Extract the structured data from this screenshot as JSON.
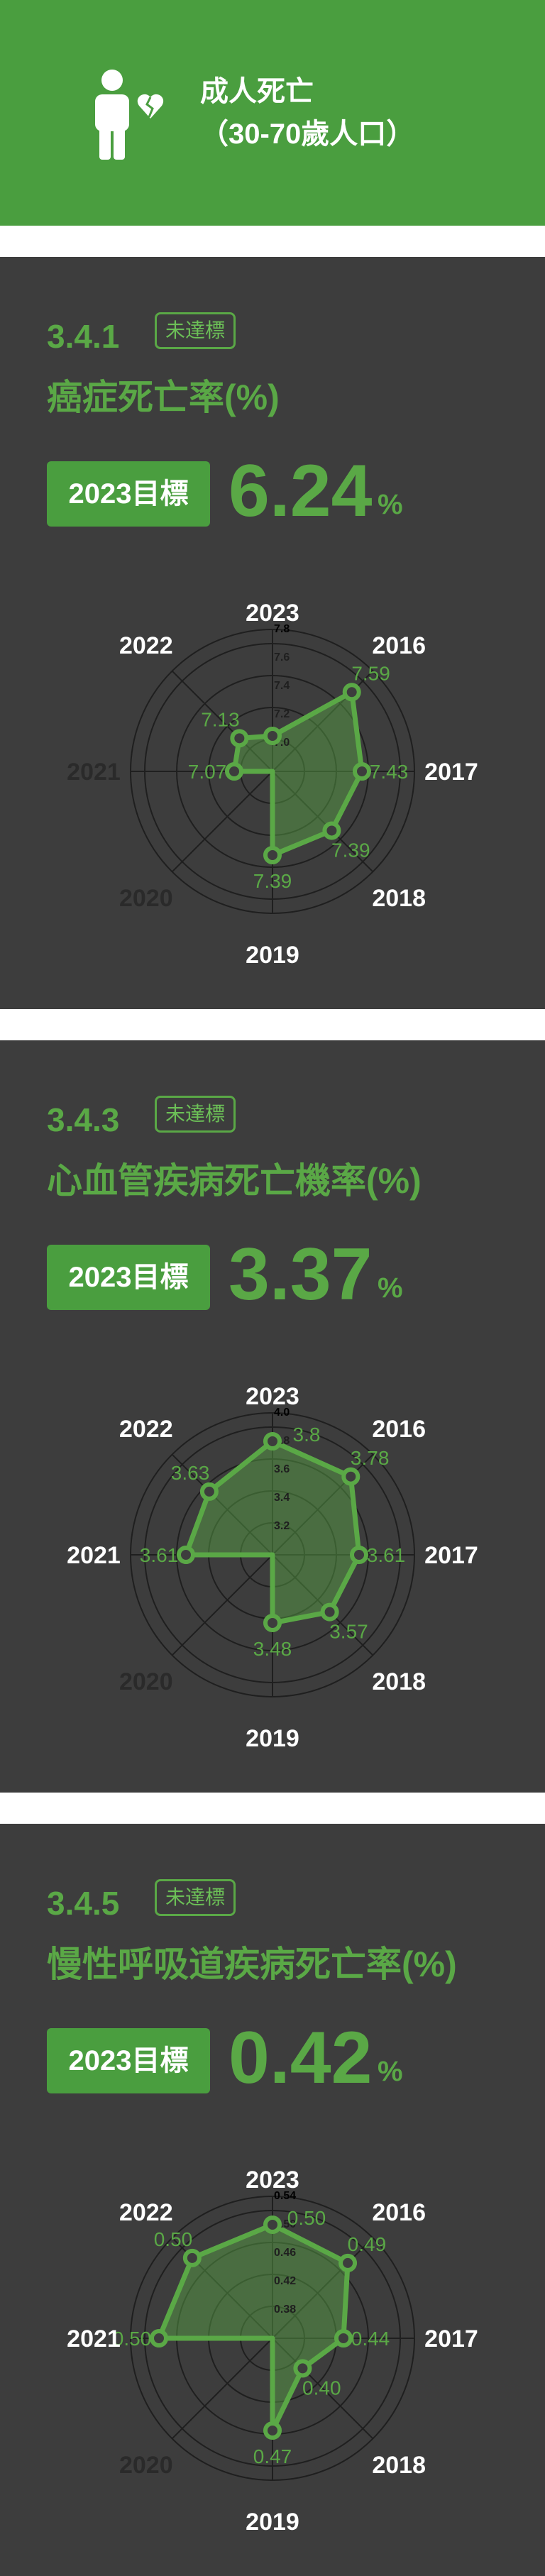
{
  "header": {
    "icon": "person-broken-heart-icon",
    "title": "成人死亡",
    "subtitle": "（30-70歲人口）"
  },
  "colors": {
    "header_bg": "#4a9e3f",
    "panel_bg": "#3d3d3d",
    "accent": "#5aa846"
  },
  "panels": [
    {
      "goal_code": "3.4.1",
      "status": "未達標",
      "metric_name": "癌症死亡率(%)",
      "target_label": "2023目標",
      "target_value": "6.24",
      "target_unit": "%",
      "chart_data": {
        "type": "radar",
        "axes": [
          "2023",
          "2016",
          "2017",
          "2018",
          "2019",
          "2020",
          "2021",
          "2022"
        ],
        "dim_axes": [
          "2020",
          "2021"
        ],
        "values": [
          7.05,
          7.59,
          7.43,
          7.39,
          7.39,
          null,
          7.07,
          7.13
        ],
        "labels": [
          "",
          "7.59",
          "7.43",
          "7.39",
          "7.39",
          "",
          "7.07",
          "7.13"
        ],
        "range": [
          6.8,
          7.8
        ],
        "ticks": [
          "7.0",
          "7.2",
          "7.4",
          "7.6",
          "7.8"
        ]
      }
    },
    {
      "goal_code": "3.4.3",
      "status": "未達標",
      "metric_name": "心血管疾病死亡機率(%)",
      "target_label": "2023目標",
      "target_value": "3.37",
      "target_unit": "%",
      "chart_data": {
        "type": "radar",
        "axes": [
          "2023",
          "2016",
          "2017",
          "2018",
          "2019",
          "2020",
          "2021",
          "2022"
        ],
        "dim_axes": [
          "2020"
        ],
        "values": [
          3.8,
          3.78,
          3.61,
          3.57,
          3.48,
          null,
          3.61,
          3.63
        ],
        "labels": [
          "3.8",
          "3.78",
          "3.61",
          "3.57",
          "3.48",
          "",
          "3.61",
          "3.63"
        ],
        "range": [
          3.0,
          4.0
        ],
        "ticks": [
          "3.2",
          "3.4",
          "3.6",
          "3.8",
          "4.0"
        ]
      }
    },
    {
      "goal_code": "3.4.5",
      "status": "未達標",
      "metric_name": "慢性呼吸道疾病死亡率(%)",
      "target_label": "2023目標",
      "target_value": "0.42",
      "target_unit": "%",
      "chart_data": {
        "type": "radar",
        "axes": [
          "2023",
          "2016",
          "2017",
          "2018",
          "2019",
          "2020",
          "2021",
          "2022"
        ],
        "dim_axes": [
          "2020"
        ],
        "values": [
          0.5,
          0.49,
          0.44,
          0.4,
          0.47,
          null,
          0.5,
          0.5
        ],
        "labels": [
          "0.50",
          "0.49",
          "0.44",
          "0.40",
          "0.47",
          "",
          "0.50",
          "0.50"
        ],
        "range": [
          0.34,
          0.54
        ],
        "ticks": [
          "0.38",
          "0.42",
          "0.46",
          "0.50",
          "0.54"
        ]
      }
    }
  ]
}
